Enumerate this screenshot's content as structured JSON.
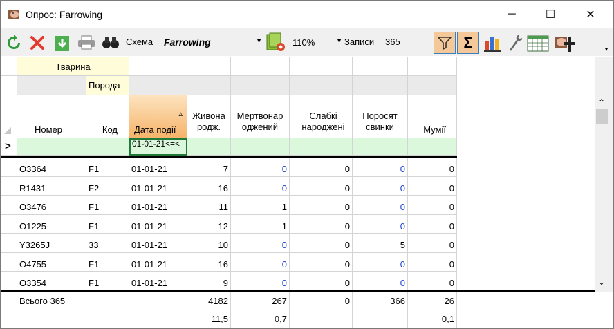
{
  "window": {
    "title": "Опрос: Farrowing",
    "min_label": "─",
    "max_label": "☐",
    "close_label": "✕"
  },
  "toolbar": {
    "scheme_label": "Схема",
    "scheme_value": "Farrowing",
    "zoom_value": "110%",
    "records_label": "Записи",
    "records_value": "365",
    "icons": [
      "refresh-icon",
      "delete-icon",
      "download-icon",
      "print-icon",
      "binoculars-icon",
      "scheme-settings-icon",
      "filter-icon",
      "sum-icon",
      "chart-icon",
      "wrench-icon",
      "calendar-icon",
      "pig-add-icon"
    ]
  },
  "grid": {
    "group_header": "Тварина",
    "subgroup_header": "Порода",
    "columns": [
      "Номер",
      "Код",
      "Дата події",
      "Живона родж.",
      "Мертвонар оджений",
      "Слабкі народжені",
      "Поросят свинки",
      "Мумії"
    ],
    "sort_indicator": "▵",
    "filter_row_marker": ">",
    "filter_value": "01-01-21<=<",
    "rows": [
      {
        "nomer": "O3364",
        "kod": "F1",
        "data": "01-01-21",
        "zhyvo": "7",
        "mertvo": "0",
        "slabki": "0",
        "porosyat": "0",
        "mumii": "0"
      },
      {
        "nomer": "R1431",
        "kod": "F2",
        "data": "01-01-21",
        "zhyvo": "16",
        "mertvo": "0",
        "slabki": "0",
        "porosyat": "0",
        "mumii": "0"
      },
      {
        "nomer": "O3476",
        "kod": "F1",
        "data": "01-01-21",
        "zhyvo": "11",
        "mertvo": "1",
        "slabki": "0",
        "porosyat": "0",
        "mumii": "0"
      },
      {
        "nomer": "O1225",
        "kod": "F1",
        "data": "01-01-21",
        "zhyvo": "12",
        "mertvo": "1",
        "slabki": "0",
        "porosyat": "0",
        "mumii": "0"
      },
      {
        "nomer": "Y3265J",
        "kod": "33",
        "data": "01-01-21",
        "zhyvo": "10",
        "mertvo": "0",
        "slabki": "0",
        "porosyat": "5",
        "mumii": "0"
      },
      {
        "nomer": "O4755",
        "kod": "F1",
        "data": "01-01-21",
        "zhyvo": "16",
        "mertvo": "0",
        "slabki": "0",
        "porosyat": "0",
        "mumii": "0"
      },
      {
        "nomer": "O3354",
        "kod": "F1",
        "data": "01-01-21",
        "zhyvo": "9",
        "mertvo": "0",
        "slabki": "0",
        "porosyat": "0",
        "mumii": "0"
      }
    ],
    "totals": {
      "label": "Всього 365",
      "zhyvo": "4182",
      "mertvo": "267",
      "slabki": "0",
      "porosyat": "366",
      "mumii": "26"
    },
    "averages": {
      "zhyvo": "11,5",
      "mertvo": "0,7",
      "mumii": "0,1"
    }
  },
  "colors": {
    "accent_blue": "#1a3fd1",
    "filter_green": "#dcf8dc",
    "header_yellow": "#fffcd9",
    "sort_orange": "#f6b46b"
  }
}
